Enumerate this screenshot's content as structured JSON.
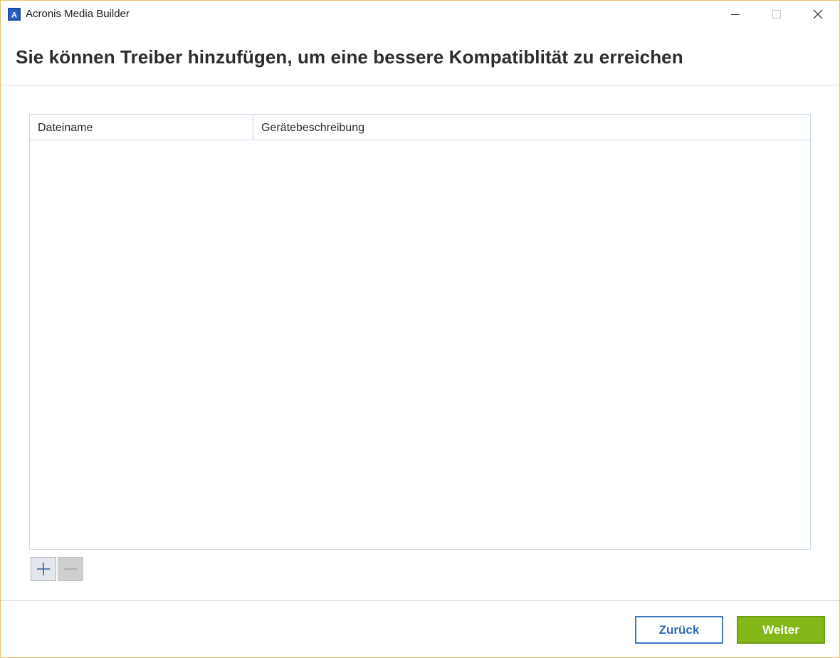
{
  "window": {
    "title": "Acronis Media Builder",
    "icon": "acronis-logo-icon",
    "icon_letter": "A",
    "controls": [
      "minimize-icon",
      "maximize-icon",
      "close-icon"
    ]
  },
  "header": {
    "title": "Sie können Treiber hinzufügen, um eine bessere Kompatiblität zu erreichen"
  },
  "driver_table": {
    "columns": [
      "Dateiname",
      "Gerätebeschreibung"
    ],
    "rows": []
  },
  "table_actions": {
    "add_icon": "plus-icon",
    "remove_icon": "minus-icon"
  },
  "footer": {
    "back_label": "Zurück",
    "next_label": "Weiter"
  },
  "colors": {
    "accent_blue": "#3f7bc0",
    "accent_green": "#84b81a",
    "window_border": "#e8c26a"
  }
}
